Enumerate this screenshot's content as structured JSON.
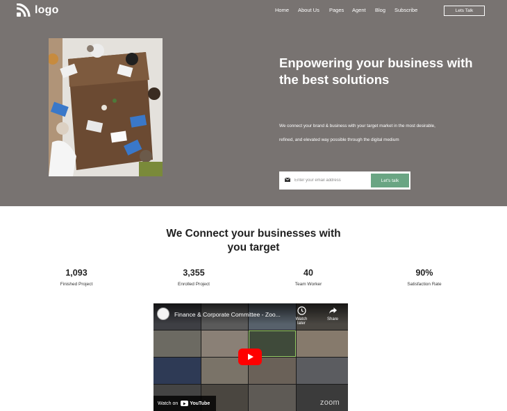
{
  "header": {
    "logo_text": "logo",
    "nav": [
      "Home",
      "About Us",
      "Pages",
      "Agent",
      "Blog",
      "Subscribe"
    ],
    "cta_label": "Lets Talk"
  },
  "hero": {
    "title": "Enpowering your business with the best solutions",
    "description": "We connect your brand & business with your target market in the most desirable, refined, and elevated way possible through the digital medium",
    "email_placeholder": "Enter your email address",
    "submit_label": "Let's talk",
    "background_color": "#787371",
    "accent_color": "#6aa583"
  },
  "connect": {
    "title_line1": "We Connect your businesses with",
    "title_line2": "you target",
    "stats": [
      {
        "value": "1,093",
        "label": "Finished Project"
      },
      {
        "value": "3,355",
        "label": "Enrolled Project"
      },
      {
        "value": "40",
        "label": "Team Worker"
      },
      {
        "value": "90%",
        "label": "Satisfaction Rate"
      }
    ]
  },
  "video": {
    "title": "Finance & Corporate Committee - Zoo...",
    "watch_later": "Watch later",
    "share": "Share",
    "watch_on": "Watch on",
    "youtube": "YouTube",
    "zoom": "zoom"
  }
}
